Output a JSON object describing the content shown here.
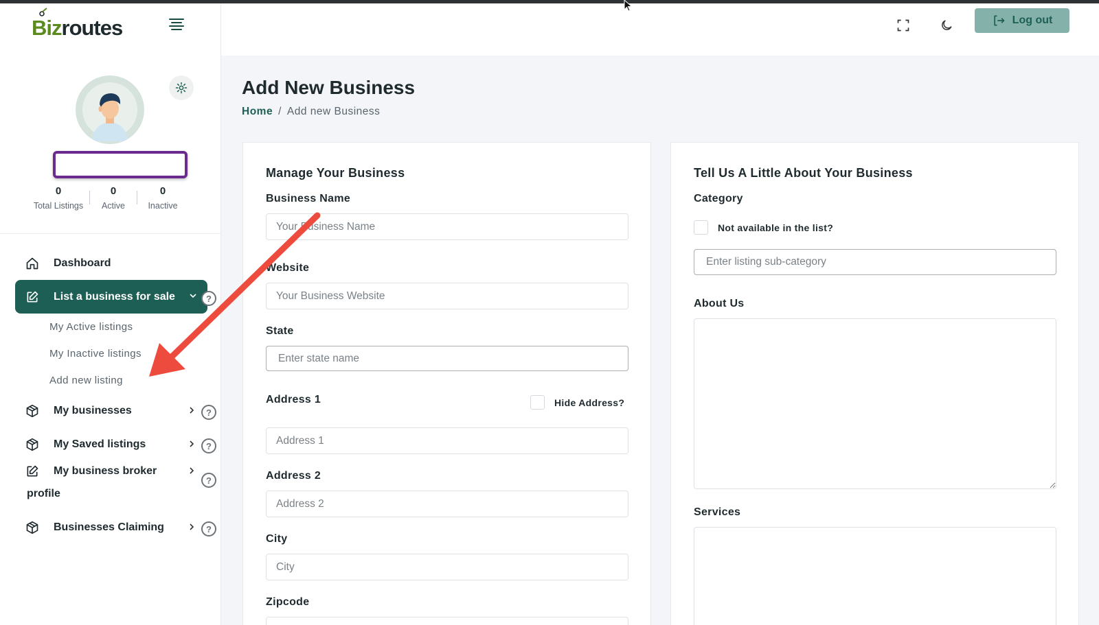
{
  "brand": {
    "logo_part1": "Biz",
    "logo_part2": "routes"
  },
  "profile": {
    "stats": [
      {
        "value": "0",
        "label": "Total Listings"
      },
      {
        "value": "0",
        "label": "Active"
      },
      {
        "value": "0",
        "label": "Inactive"
      }
    ]
  },
  "nav": {
    "dashboard": "Dashboard",
    "list_business": "List a business for sale",
    "sub_active": "My Active listings",
    "sub_inactive": "My Inactive listings",
    "sub_add": "Add new listing",
    "my_businesses": "My businesses",
    "saved_listings": "My Saved listings",
    "broker_profile_line1": "My business broker",
    "broker_profile_line2": "profile",
    "claiming": "Businesses Claiming",
    "help_glyph": "?"
  },
  "topbar": {
    "logout": "Log out"
  },
  "page": {
    "title": "Add New Business",
    "breadcrumb_home": "Home",
    "breadcrumb_sep": "/",
    "breadcrumb_current": "Add new Business"
  },
  "manage": {
    "title": "Manage Your Business",
    "business_name_label": "Business Name",
    "business_name_placeholder": "Your Business Name",
    "website_label": "Website",
    "website_placeholder": "Your Business Website",
    "state_label": "State",
    "state_placeholder": "Enter state name",
    "address1_label": "Address 1",
    "hide_address_label": "Hide Address?",
    "address1_placeholder": "Address 1",
    "address2_label": "Address 2",
    "address2_placeholder": "Address 2",
    "city_label": "City",
    "city_placeholder": "City",
    "zipcode_label": "Zipcode"
  },
  "about": {
    "title": "Tell Us A Little About Your Business",
    "category_label": "Category",
    "not_available_label": "Not available in the list?",
    "subcategory_placeholder": "Enter listing sub-category",
    "about_label": "About Us",
    "services_label": "Services"
  },
  "colors": {
    "primary": "#1d5f55",
    "logout_bg": "#84b1a9",
    "name_box_border": "#6a2a8e",
    "annotation_arrow": "#ee4b3f"
  }
}
